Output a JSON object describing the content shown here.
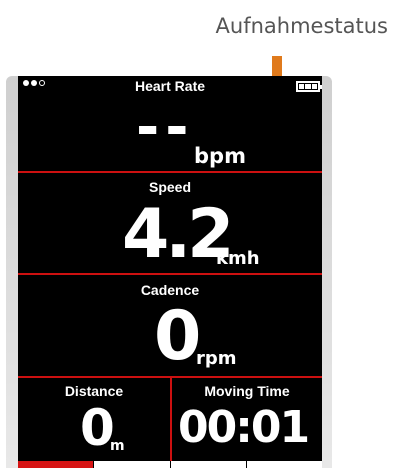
{
  "annotation": {
    "label": "Aufnahmestatus",
    "arrow_color": "#e07a1c"
  },
  "status_bar": {
    "signal_icon": "signal-dots-icon",
    "title": "Heart Rate",
    "battery_icon": "battery-icon"
  },
  "heart_rate": {
    "value": "--",
    "unit": "bpm"
  },
  "speed": {
    "label": "Speed",
    "value": "4.2",
    "unit": "kmh"
  },
  "cadence": {
    "label": "Cadence",
    "value": "0",
    "unit": "rpm"
  },
  "distance": {
    "label": "Distance",
    "value": "0",
    "unit": "m"
  },
  "moving_time": {
    "label": "Moving Time",
    "value": "00:01"
  },
  "page_tabs": {
    "count": 4,
    "active_index": 0
  },
  "colors": {
    "screen": "#000000",
    "divider": "#cc1010",
    "text": "#ffffff"
  }
}
